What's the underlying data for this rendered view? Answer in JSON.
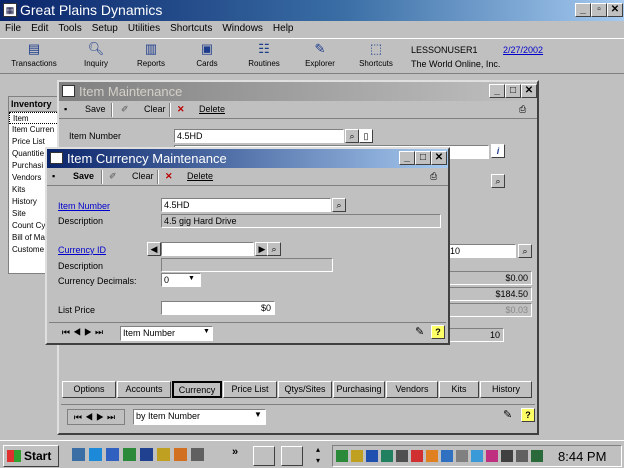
{
  "app": {
    "title": "Great Plains Dynamics",
    "menu": [
      "File",
      "Edit",
      "Tools",
      "Setup",
      "Utilities",
      "Shortcuts",
      "Windows",
      "Help"
    ],
    "toolbar": [
      "Transactions",
      "Inquiry",
      "Reports",
      "Cards",
      "Routines",
      "Explorer",
      "Shortcuts"
    ],
    "user": "LESSONUSER1",
    "date": "2/27/2002",
    "company": "The World Online, Inc."
  },
  "nav": {
    "header": "Inventory",
    "items": [
      "Item",
      "Item Curren",
      "Price List",
      "Quantitie",
      "Purchasi",
      "Vendors",
      "Kits",
      "History",
      "Site",
      "Count Cy",
      "Bill of Ma",
      "Custome"
    ]
  },
  "item_maintenance": {
    "title": "Item Maintenance",
    "save": "Save",
    "clear": "Clear",
    "delete": "Delete",
    "item_number_label": "Item Number",
    "item_number": "4.5HD",
    "currency_suffix": "-10",
    "amount1": "$0.00",
    "amount2": "$184.50",
    "amount3": "$0.03",
    "qty": "10",
    "buttons": [
      "Options",
      "Accounts",
      "Currency",
      "Price List",
      "Qtys/Sites",
      "Purchasing",
      "Vendors",
      "Kits",
      "History"
    ],
    "browse_by": "by Item Number"
  },
  "item_currency": {
    "title": "Item Currency Maintenance",
    "save": "Save",
    "clear": "Clear",
    "delete": "Delete",
    "item_number_label": "Item Number",
    "item_number": "4.5HD",
    "description_label": "Description",
    "description": "4.5 gig Hard Drive",
    "currency_id_label": "Currency ID",
    "currency_id": "",
    "currency_description_label": "Description",
    "currency_decimals_label": "Currency Decimals:",
    "currency_decimals": "0",
    "list_price_label": "List Price",
    "list_price": "$0",
    "browse_by": "Item Number"
  },
  "taskbar": {
    "start": "Start",
    "clock": "8:44 PM"
  }
}
